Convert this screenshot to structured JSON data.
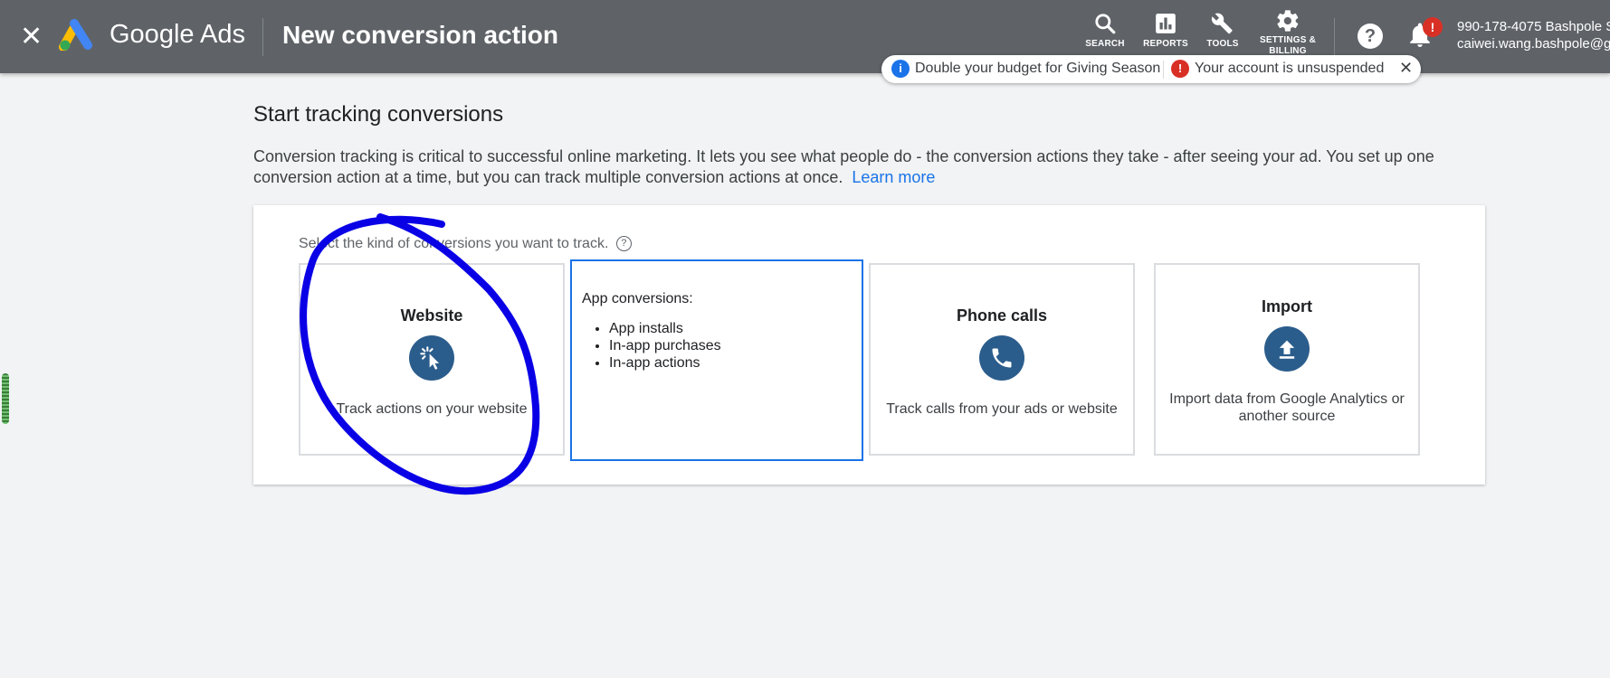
{
  "header": {
    "close_label": "✕",
    "brand": "Google Ads",
    "page_title": "New conversion action",
    "tools": [
      {
        "label": "SEARCH"
      },
      {
        "label": "REPORTS"
      },
      {
        "label": "TOOLS"
      },
      {
        "label": "SETTINGS & BILLING"
      }
    ],
    "help_label": "?",
    "bell_badge": "!",
    "account_id": "990-178-4075 Bashpole S",
    "account_email": "caiwei.wang.bashpole@g"
  },
  "notifications": {
    "items": [
      {
        "icon": "i",
        "text": "Double your budget for Giving Season",
        "type": "info"
      },
      {
        "icon": "!",
        "text": "Your account is unsuspended",
        "type": "warning"
      }
    ],
    "close_label": "✕"
  },
  "main": {
    "title": "Start tracking conversions",
    "description": "Conversion tracking is critical to successful online marketing. It lets you see what people do - the conversion actions they take - after seeing your ad. You set up one conversion action at a time, but you can track multiple conversion actions at once.",
    "learn_more": "Learn more",
    "select_prompt": "Select the kind of conversions you want to track.",
    "select_help": "?",
    "cards": [
      {
        "title": "Website",
        "description": "Track actions on your website",
        "icon": "cursor-click-icon"
      },
      {
        "heading": "App conversions:",
        "items": [
          "App installs",
          "In-app purchases",
          "In-app actions"
        ],
        "selected": true
      },
      {
        "title": "Phone calls",
        "description": "Track calls from your ads or website",
        "icon": "phone-icon"
      },
      {
        "title": "Import",
        "description": "Import data from Google Analytics or another source",
        "icon": "upload-icon"
      }
    ]
  },
  "colors": {
    "topbar": "#5f6368",
    "accent": "#1a73e8",
    "icon_circle": "#2b5d8c",
    "annotation_stroke": "#0a00e6"
  }
}
